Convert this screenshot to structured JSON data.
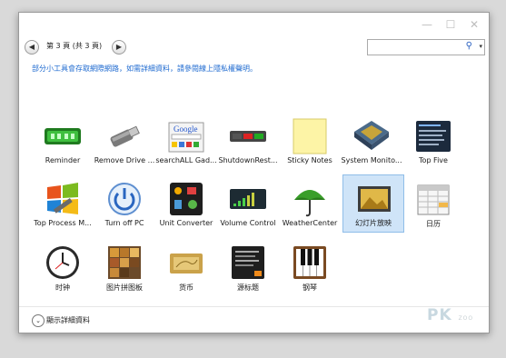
{
  "window": {
    "minimize": "—",
    "maximize": "☐",
    "close": "✕"
  },
  "toolbar": {
    "back": "◀",
    "forward": "▶",
    "page_info": "第 3 頁 (共 3 頁)",
    "search_placeholder": "",
    "search_icon": "⚲",
    "search_dropdown": "▾"
  },
  "info_link": "部分小工具會存取網際網路，如需詳細資料，請參閱線上隱私權聲明。",
  "gadgets": [
    {
      "label": "Reminder",
      "icon": "green-clock-display-icon"
    },
    {
      "label": "Remove Drive ...",
      "icon": "usb-drive-icon"
    },
    {
      "label": "searchALL Gad...",
      "icon": "google-search-icon"
    },
    {
      "label": "ShutdownRest...",
      "icon": "shutdown-panel-icon"
    },
    {
      "label": "Sticky Notes",
      "icon": "sticky-note-icon"
    },
    {
      "label": "System Monito...",
      "icon": "cpu-chip-icon"
    },
    {
      "label": "Top Five",
      "icon": "process-list-icon"
    },
    {
      "label": "Top Process M...",
      "icon": "windows-flag-icon"
    },
    {
      "label": "Turn off PC",
      "icon": "power-icon"
    },
    {
      "label": "Unit Converter",
      "icon": "unit-converter-icon"
    },
    {
      "label": "Volume Control",
      "icon": "volume-meter-icon"
    },
    {
      "label": "WeatherCenter",
      "icon": "umbrella-icon"
    },
    {
      "label": "幻灯片放映",
      "icon": "slideshow-photo-icon",
      "selected": true
    },
    {
      "label": "日历",
      "icon": "calendar-icon"
    },
    {
      "label": "时钟",
      "icon": "clock-icon"
    },
    {
      "label": "图片拼图板",
      "icon": "picture-puzzle-icon"
    },
    {
      "label": "货币",
      "icon": "currency-card-icon"
    },
    {
      "label": "源标题",
      "icon": "feed-headlines-icon"
    },
    {
      "label": "钢琴",
      "icon": "piano-keys-icon"
    }
  ],
  "footer": {
    "toggle": "⌄",
    "details_label": "顯示詳細資料"
  },
  "watermark": {
    "brand": "PK",
    "suffix": "ZOO"
  },
  "colors": {
    "link": "#1e6ad0",
    "selection": "#cfe4f8"
  }
}
